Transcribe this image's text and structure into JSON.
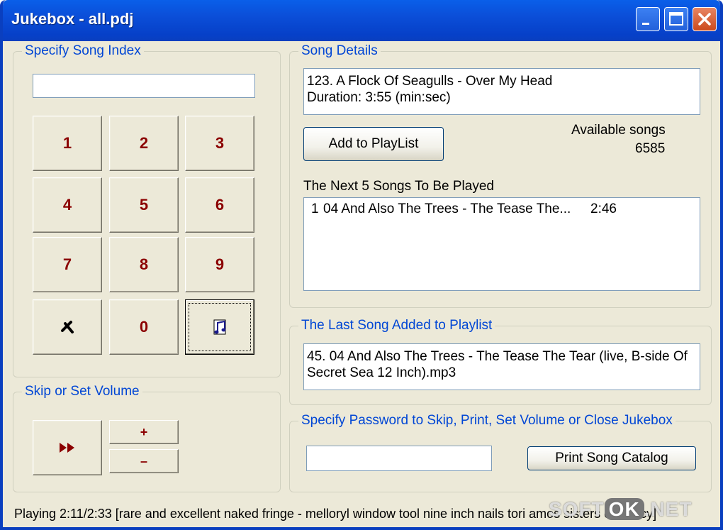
{
  "window": {
    "title": "Jukebox - all.pdj"
  },
  "index_group": {
    "legend": "Specify Song Index",
    "input_value": "",
    "keys": [
      "1",
      "2",
      "3",
      "4",
      "5",
      "6",
      "7",
      "8",
      "9",
      "0"
    ]
  },
  "volume_group": {
    "legend": "Skip or Set Volume",
    "plus": "+",
    "minus": "–"
  },
  "details_group": {
    "legend": "Song Details",
    "line1": "123. A Flock Of Seagulls - Over My Head",
    "line2": "Duration: 3:55 (min:sec)",
    "add_button": "Add to PlayList",
    "available_label": "Available songs",
    "available_count": "6585",
    "next_label": "The Next 5 Songs To Be Played",
    "playlist": [
      {
        "num": "1",
        "title": "04 And Also The Trees - The Tease The...",
        "time": "2:46"
      }
    ]
  },
  "last_group": {
    "legend": "The Last Song Added to Playlist",
    "line1": "45. 04 And Also The Trees - The Tease The Tear (live, B-side Of",
    "line2": "Secret Sea 12 Inch).mp3"
  },
  "password_group": {
    "legend": "Specify Password to Skip, Print, Set Volume or Close Jukebox",
    "input_value": "",
    "print_button": "Print Song Catalog"
  },
  "status": "Playing 2:11/2:33 [rare and excellent naked fringe - melloryl window tool nine inch nails tori amos sisters of mercy]",
  "watermark": {
    "part1": "SOFT",
    "part2": "OK",
    "part3": ".NET"
  },
  "colors": {
    "title_bar": "#0a5fe9",
    "legend": "#0046d5",
    "key_text": "#8b0000"
  }
}
